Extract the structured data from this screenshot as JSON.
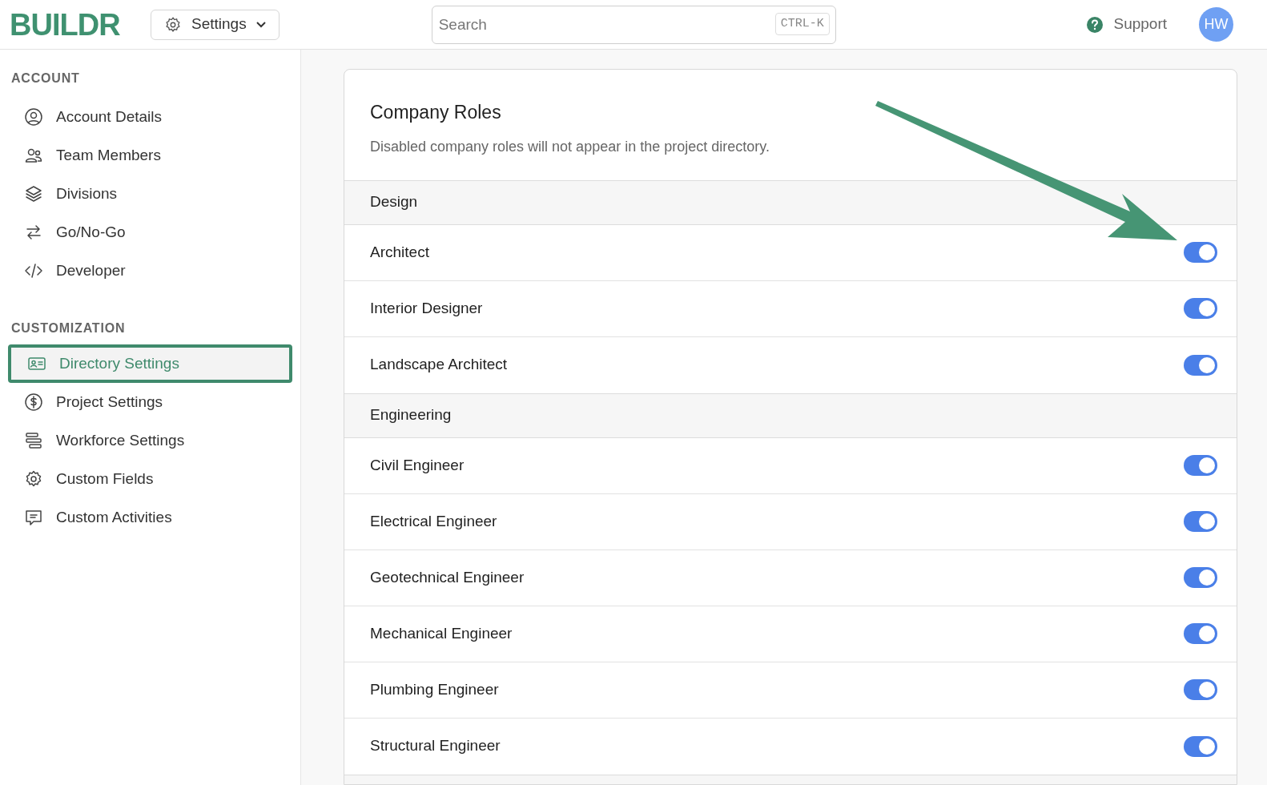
{
  "header": {
    "logo": "BUILDR",
    "menu": "Settings",
    "search": {
      "placeholder": "Search",
      "shortcut": "CTRL-K"
    },
    "support": "Support",
    "avatar": "HW"
  },
  "sidebar": {
    "sections": [
      {
        "title": "ACCOUNT",
        "items": [
          {
            "label": "Account Details",
            "selected": false
          },
          {
            "label": "Team Members",
            "selected": false
          },
          {
            "label": "Divisions",
            "selected": false
          },
          {
            "label": "Go/No-Go",
            "selected": false
          },
          {
            "label": "Developer",
            "selected": false
          }
        ]
      },
      {
        "title": "CUSTOMIZATION",
        "items": [
          {
            "label": "Directory Settings",
            "selected": true
          },
          {
            "label": "Project Settings",
            "selected": false
          },
          {
            "label": "Workforce Settings",
            "selected": false
          },
          {
            "label": "Custom Fields",
            "selected": false
          },
          {
            "label": "Custom Activities",
            "selected": false
          }
        ]
      }
    ]
  },
  "card": {
    "title": "Company Roles",
    "description": "Disabled company roles will not appear in the project directory.",
    "groups": [
      {
        "name": "Design",
        "roles": [
          {
            "name": "Architect",
            "on": true
          },
          {
            "name": "Interior Designer",
            "on": true
          },
          {
            "name": "Landscape Architect",
            "on": true
          }
        ]
      },
      {
        "name": "Engineering",
        "roles": [
          {
            "name": "Civil Engineer",
            "on": true
          },
          {
            "name": "Electrical Engineer",
            "on": true
          },
          {
            "name": "Geotechnical Engineer",
            "on": true
          },
          {
            "name": "Mechanical Engineer",
            "on": true
          },
          {
            "name": "Plumbing Engineer",
            "on": true
          },
          {
            "name": "Structural Engineer",
            "on": true
          }
        ]
      }
    ]
  }
}
